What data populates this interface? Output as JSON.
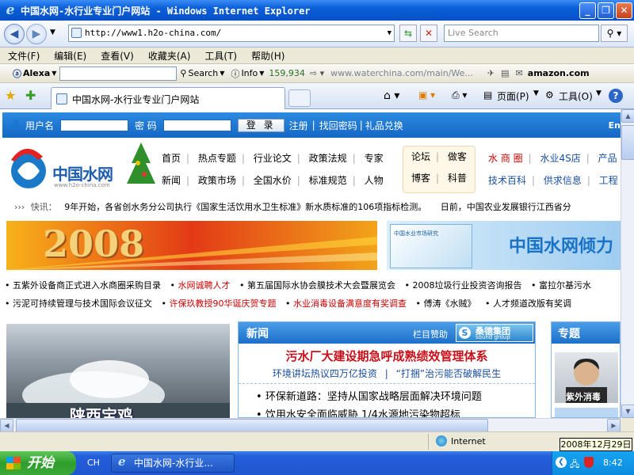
{
  "window": {
    "title": "中国水网-水行业专业门户网站 - Windows Internet Explorer",
    "min": "_",
    "max": "❐",
    "close": "✕"
  },
  "address": {
    "url": "http://www1.h2o-china.com/",
    "search_placeholder": "Live Search"
  },
  "menu": [
    "文件(F)",
    "编辑(E)",
    "查看(V)",
    "收藏夹(A)",
    "工具(T)",
    "帮助(H)"
  ],
  "alexa": {
    "brand": "Alexa",
    "search_label": "Search",
    "info_label": "Info",
    "rank": "159,934",
    "link": "www.waterchina.com/main/We...",
    "amazon": "amazon.com"
  },
  "tab": {
    "title": "中国水网-水行业专业门户网站",
    "page_label": "页面(P)",
    "tools_label": "工具(O)",
    "help_label": "?"
  },
  "login": {
    "user_label": "用户名",
    "pwd_label": "密  码",
    "login_button": "登 录",
    "register": "注册",
    "retrieve": "找回密码",
    "gift": "礼品兑换",
    "lang": "En"
  },
  "logo": {
    "text": "中国水网",
    "sub": "www.h2o-china.com"
  },
  "nav": {
    "group1_row1": [
      "首页",
      "热点专题",
      "行业论文",
      "政策法规",
      "专家"
    ],
    "group1_row2": [
      "新闻",
      "政策市场",
      "全国水价",
      "标准规范",
      "人物"
    ],
    "group2_row1": [
      "论坛",
      "做客"
    ],
    "group2_row2": [
      "博客",
      "科普"
    ],
    "group3_row1": [
      "水 商 圈",
      "水业4S店",
      "产品"
    ],
    "group3_row2": [
      "技术百科",
      "供求信息",
      "工程"
    ]
  },
  "flash": {
    "label": "快讯：",
    "item1": "9年开始，各省创水务分公司执行《国家生活饮用水卫生标准》新水质标准的106项指标检测。",
    "item2": "日前，中国农业发展银行江西省分"
  },
  "banners": {
    "year": "2008",
    "right_text": "中国水网倾力",
    "right_book": "中国水业市场研究"
  },
  "links_row1": [
    "五紫外设备商正式进入水商圈采购目录",
    "水网诚聘人才",
    "第五届国际水协会膜技术大会暨展览会",
    "2008垃圾行业投资咨询报告",
    "富拉尔基污水"
  ],
  "links_row2": [
    "污泥可持续管理与技术国际会议征文",
    "许保玖教授90华诞庆贺专题",
    "水业消毒设备满意度有奖调查",
    "傅涛《水贼》",
    "人才频道改版有奖调"
  ],
  "news": {
    "header": "新闻",
    "sponsor_label": "栏目赞助",
    "sponsor_name": "桑德集团",
    "sponsor_en": "sound group",
    "headline": "污水厂大建设期急呼成熟绩效管理体系",
    "sub1": "环境讲坛热议四万亿投资",
    "sub_sep": "|",
    "sub2": "“打捆”治污能否破解民生",
    "item1": "环保新道路：坚持从国家战略层面解决环境问题",
    "item2": "饮用水安全面临威胁  1/4水源地污染物超标"
  },
  "pic_caption": "陕西宝鸡",
  "topic": {
    "header": "专题",
    "caption": "紫外消毒"
  },
  "status": {
    "zone": "Internet"
  },
  "taskbar": {
    "start": "开始",
    "lang": "CH",
    "task": "中国水网-水行业...",
    "clock": "8:42",
    "date_tooltip": "2008年12月29日"
  }
}
